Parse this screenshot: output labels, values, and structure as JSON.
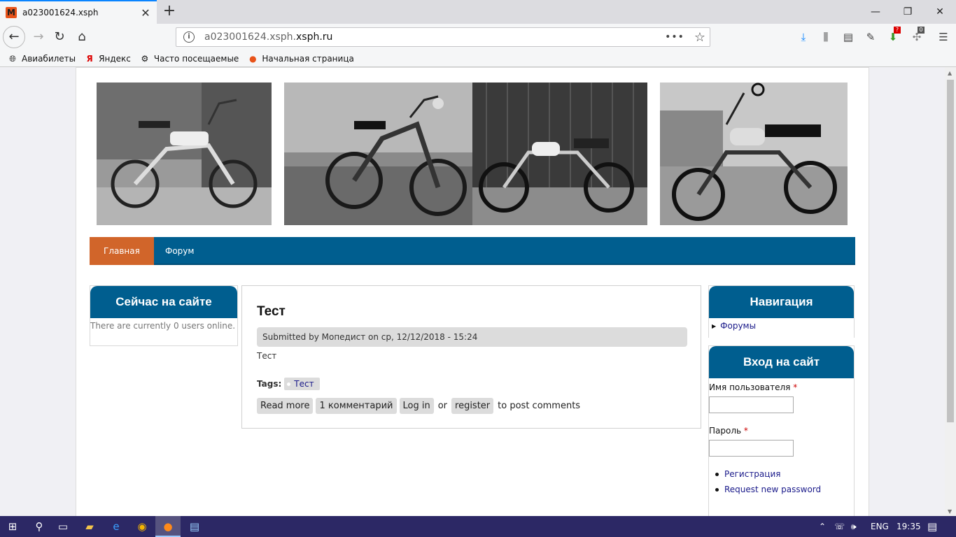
{
  "browser": {
    "tab_title": "a023001624.xsph",
    "tab_favicon_letter": "M",
    "url_prefix": "a023001624.xsph.",
    "url_domain": "xsph.ru",
    "bookmarks": [
      {
        "icon": "globe-icon",
        "label": "Авиабилеты"
      },
      {
        "icon": "yandex-icon",
        "label": "Яндекс"
      },
      {
        "icon": "gear-icon",
        "label": "Часто посещаемые"
      },
      {
        "icon": "firefox-icon",
        "label": "Начальная страница"
      }
    ],
    "addon_badge": "?",
    "addon_badge_2": "0"
  },
  "site": {
    "menu": [
      {
        "label": "Главная",
        "active": true
      },
      {
        "label": "Форум",
        "active": false
      }
    ],
    "left_block": {
      "title": "Сейчас на сайте",
      "text": "There are currently 0 users online."
    },
    "node": {
      "title": "Тест",
      "submitted": "Submitted by Мопедист on ср, 12/12/2018 - 15:24",
      "body": "Тест",
      "tags_label": "Tags:",
      "tag": "Тест",
      "read_more": "Read more",
      "comments": "1 комментарий",
      "login": "Log in",
      "or": "or",
      "register": "register",
      "to_post": "to post comments"
    },
    "nav_block": {
      "title": "Навигация",
      "items": [
        "Форумы"
      ]
    },
    "login_block": {
      "title": "Вход на сайт",
      "username_label": "Имя пользователя",
      "password_label": "Пароль",
      "required_mark": "*",
      "links": [
        "Регистрация",
        "Request new password"
      ]
    }
  },
  "taskbar": {
    "lang": "ENG",
    "time": "19:35"
  }
}
